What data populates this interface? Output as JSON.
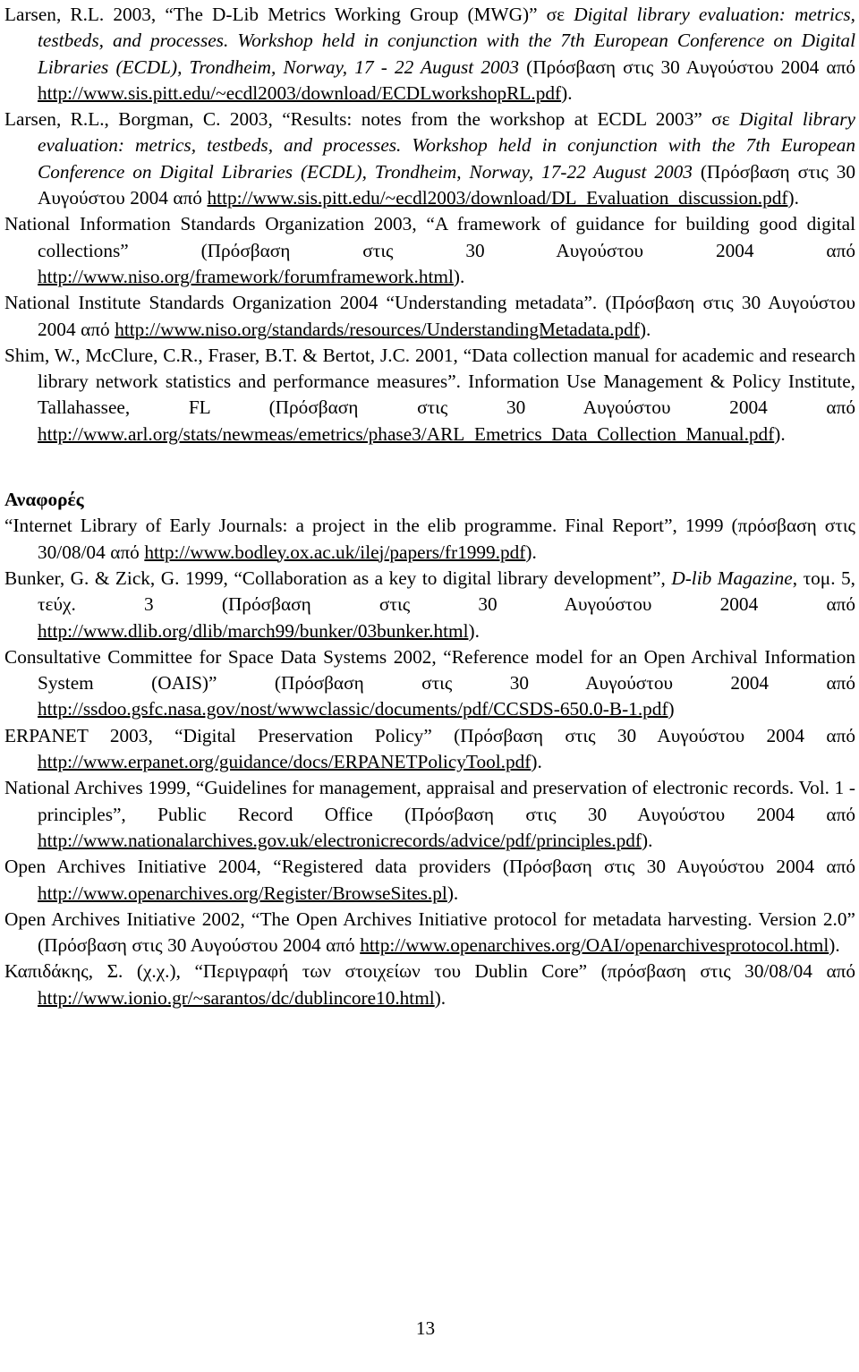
{
  "document": {
    "type": "bibliography-page",
    "language": "el-GR/en",
    "page_number": "13",
    "section_heading": "Αναφορές"
  },
  "references_before_heading": [
    {
      "id": "larsen-2003-mwg",
      "parts": [
        {
          "text": "Larsen, R.L. 2003, “The D-Lib Metrics Working Group (MWG)” σε ",
          "style": "normal"
        },
        {
          "text": "Digital library evaluation: metrics, testbeds, and processes. Workshop held in conjunction with the 7th European Conference on Digital Libraries (ECDL), Trondheim, Norway, 17 - 22 August 2003 ",
          "style": "italic"
        },
        {
          "text": "(Πρόσβαση στις 30 Αυγούστου 2004 από ",
          "style": "normal"
        },
        {
          "text": "http://www.sis.pitt.edu/~ecdl2003/download/ECDLworkshopRL.pdf",
          "style": "link"
        },
        {
          "text": ").",
          "style": "normal"
        }
      ]
    },
    {
      "id": "larsen-borgman-2003",
      "parts": [
        {
          "text": "Larsen, R.L., Borgman, C. 2003, “Results: notes from the workshop at ECDL 2003” σε ",
          "style": "normal"
        },
        {
          "text": "Digital library evaluation: metrics, testbeds, and processes. Workshop held in conjunction with the 7th European Conference on Digital Libraries (ECDL), Trondheim, Norway, 17-22 August 2003 ",
          "style": "italic"
        },
        {
          "text": "(Πρόσβαση στις 30 Αυγούστου 2004 από ",
          "style": "normal"
        },
        {
          "text": "http://www.sis.pitt.edu/~ecdl2003/download/DL_Evaluation_discussion.pdf",
          "style": "link"
        },
        {
          "text": ").",
          "style": "normal"
        }
      ]
    },
    {
      "id": "niso-2003-framework",
      "parts": [
        {
          "text": "National Information Standards Organization 2003, “A framework of guidance for building good digital collections” (Πρόσβαση στις 30 Αυγούστου 2004 από ",
          "style": "normal"
        },
        {
          "text": "http://www.niso.org/framework/forumframework.html",
          "style": "link"
        },
        {
          "text": ").",
          "style": "normal"
        }
      ]
    },
    {
      "id": "niso-2004-metadata",
      "parts": [
        {
          "text": "National Institute Standards Organization 2004 “Understanding metadata”. (Πρόσβαση στις 30 Αυγούστου 2004 από ",
          "style": "normal"
        },
        {
          "text": "http://www.niso.org/standards/resources/UnderstandingMetadata.pdf",
          "style": "link"
        },
        {
          "text": ").",
          "style": "normal"
        }
      ]
    },
    {
      "id": "shim-2001-data-collection",
      "parts": [
        {
          "text": "Shim, W., McClure, C.R., Fraser, B.T. & Bertot, J.C. 2001, “Data collection manual for academic and research library network statistics and performance measures”. Information Use Management & Policy Institute, Tallahassee, FL (Πρόσβαση στις 30 Αυγούστου 2004 από ",
          "style": "normal"
        },
        {
          "text": "http://www.arl.org/stats/newmeas/emetrics/phase3/ARL_Emetrics_Data_Collection_Manual.pdf",
          "style": "link"
        },
        {
          "text": ").",
          "style": "normal"
        }
      ]
    }
  ],
  "references_after_heading": [
    {
      "id": "ilej-1999",
      "parts": [
        {
          "text": "“Internet Library of Early Journals: a project in the elib programme. Final Report”, 1999 (πρόσβαση στις 30/08/04 από ",
          "style": "normal"
        },
        {
          "text": "http://www.bodley.ox.ac.uk/ilej/papers/fr1999.pdf",
          "style": "link"
        },
        {
          "text": ").",
          "style": "normal"
        }
      ]
    },
    {
      "id": "bunker-zick-1999",
      "parts": [
        {
          "text": "Bunker, G. & Zick, G. 1999, “Collaboration as a key to digital library development”, ",
          "style": "normal"
        },
        {
          "text": "D-lib Magazine",
          "style": "italic"
        },
        {
          "text": ", τομ. 5, τεύχ. 3 (Πρόσβαση στις 30 Αυγούστου 2004 από ",
          "style": "normal"
        },
        {
          "text": "http://www.dlib.org/dlib/march99/bunker/03bunker.html",
          "style": "link"
        },
        {
          "text": ").",
          "style": "normal"
        }
      ]
    },
    {
      "id": "ccsds-2002-oais",
      "parts": [
        {
          "text": "Consultative Committee for Space Data Systems 2002, “Reference model for an Open Archival Information System (OAIS)” (Πρόσβαση στις 30 Αυγούστου 2004 από ",
          "style": "normal"
        },
        {
          "text": "http://ssdoo.gsfc.nasa.gov/nost/wwwclassic/documents/pdf/CCSDS-650.0-B-1.pdf",
          "style": "link"
        },
        {
          "text": ")",
          "style": "normal"
        }
      ]
    },
    {
      "id": "erpanet-2003",
      "parts": [
        {
          "text": "ERPANET 2003, “Digital Preservation Policy” (Πρόσβαση στις 30 Αυγούστου 2004 από ",
          "style": "normal"
        },
        {
          "text": "http://www.erpanet.org/guidance/docs/ERPANETPolicyTool.pdf",
          "style": "link"
        },
        {
          "text": ").",
          "style": "normal"
        }
      ]
    },
    {
      "id": "national-archives-1999",
      "parts": [
        {
          "text": "National Archives 1999, “Guidelines for management, appraisal and preservation of electronic records. Vol. 1 - principles”, Public Record Office (Πρόσβαση στις 30 Αυγούστου 2004 από ",
          "style": "normal"
        },
        {
          "text": "http://www.nationalarchives.gov.uk/electronicrecords/advice/pdf/principles.pdf",
          "style": "link"
        },
        {
          "text": ").",
          "style": "normal"
        }
      ]
    },
    {
      "id": "oai-2004-registered",
      "parts": [
        {
          "text": "Open Archives Initiative 2004, “Registered data providers (Πρόσβαση στις 30 Αυγούστου 2004 από ",
          "style": "normal"
        },
        {
          "text": "http://www.openarchives.org/Register/BrowseSites.pl",
          "style": "link"
        },
        {
          "text": ").",
          "style": "normal"
        }
      ]
    },
    {
      "id": "oai-2002-protocol",
      "parts": [
        {
          "text": "Open Archives Initiative 2002, “The Open Archives Initiative protocol for metadata harvesting. Version 2.0” (Πρόσβαση στις 30 Αυγούστου 2004 από ",
          "style": "normal"
        },
        {
          "text": "http://www.openarchives.org/OAI/openarchivesprotocol.html",
          "style": "link"
        },
        {
          "text": ").",
          "style": "normal"
        }
      ]
    },
    {
      "id": "kapidakis-dublin-core",
      "parts": [
        {
          "text": "Καπιδάκης, Σ. (χ.χ.), “Περιγραφή των στοιχείων του Dublin Core” (πρόσβαση στις 30/08/04 από ",
          "style": "normal"
        },
        {
          "text": "http://www.ionio.gr/~sarantos/dc/dublincore10.html",
          "style": "link"
        },
        {
          "text": ").",
          "style": "normal"
        }
      ]
    }
  ]
}
